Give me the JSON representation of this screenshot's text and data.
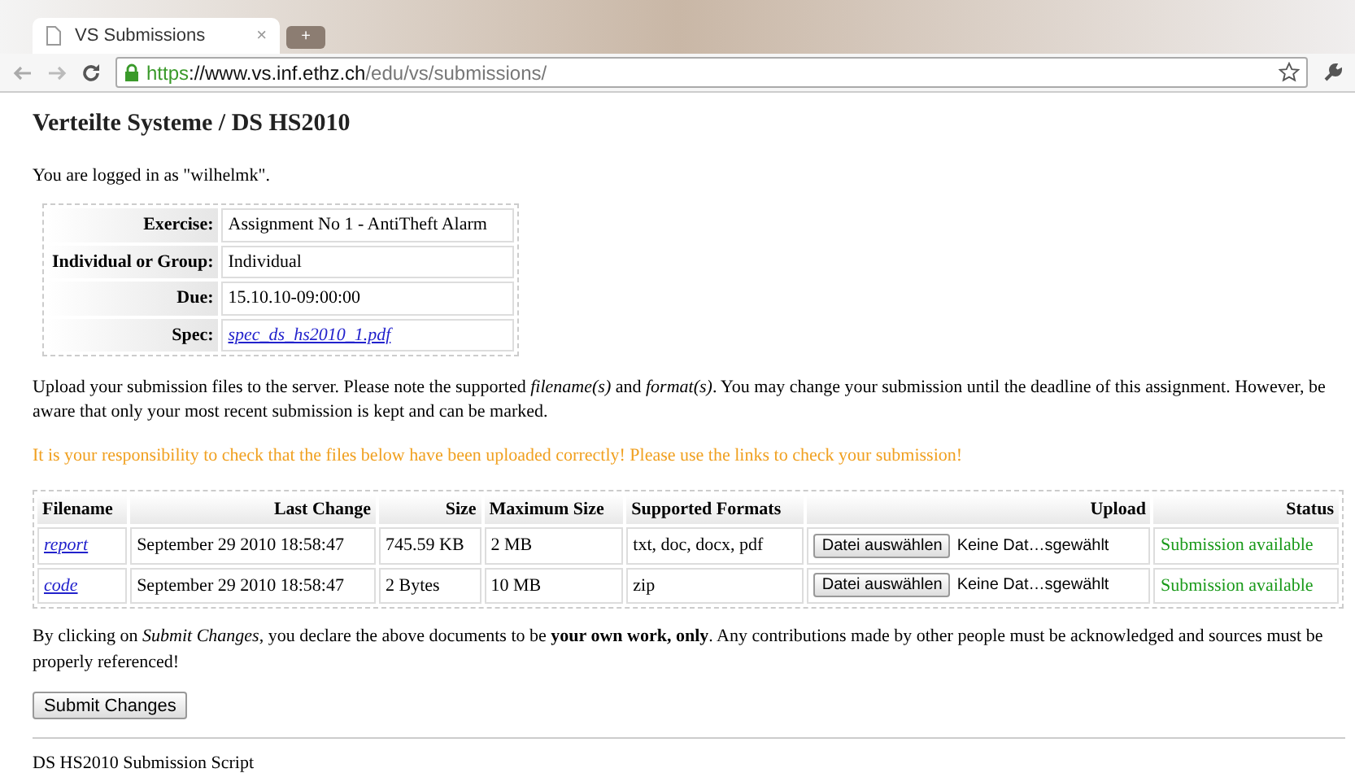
{
  "browser": {
    "tab_title": "VS Submissions",
    "tab_close": "×",
    "new_tab": "+",
    "url_scheme": "https",
    "url_host": "://www.vs.inf.ethz.ch",
    "url_path": "/edu/vs/submissions/"
  },
  "page": {
    "title": "Verteilte Systeme / DS HS2010",
    "login": "You are logged in as \"wilhelmk\".",
    "info": [
      {
        "label": "Exercise:",
        "value": "Assignment No 1 - AntiTheft Alarm",
        "kind": "text"
      },
      {
        "label": "Individual or Group:",
        "value": "Individual",
        "kind": "text"
      },
      {
        "label": "Due:",
        "value": "15.10.10-09:00:00",
        "kind": "text"
      },
      {
        "label": "Spec:",
        "value": "spec_ds_hs2010_1.pdf",
        "kind": "link"
      }
    ],
    "intro": "Upload your submission files to the server. Please note the supported *filename(s)* and *format(s)*. You may change your submission until the deadline of this assignment. However, be aware that only your most recent submission is kept and can be marked.",
    "warning": "It is your responsibility to check that the files below have been uploaded correctly! Please use the links to check your submission!",
    "table": {
      "columns": [
        "Filename",
        "Last Change",
        "Size",
        "Maximum Size",
        "Supported Formats",
        "Upload",
        "Status"
      ],
      "rows": [
        {
          "filename": "report",
          "last_change": "September 29 2010 18:58:47",
          "size": "745.59 KB",
          "max_size": "2 MB",
          "formats": "txt, doc, docx, pdf",
          "button": "Datei auswählen",
          "file": "Keine Dat…sgewählt",
          "status": "Submission available"
        },
        {
          "filename": "code",
          "last_change": "September 29 2010 18:58:47",
          "size": "2 Bytes",
          "max_size": "10 MB",
          "formats": "zip",
          "button": "Datei auswählen",
          "file": "Keine Dat…sgewählt",
          "status": "Submission available"
        }
      ]
    },
    "declaration": "By clicking on *Submit Changes*, you declare the above documents to be **your own work, only**. Any contributions made by other people must be acknowledged and sources must be properly referenced!",
    "submit": "Submit Changes",
    "footer": "DS HS2010 Submission Script"
  }
}
